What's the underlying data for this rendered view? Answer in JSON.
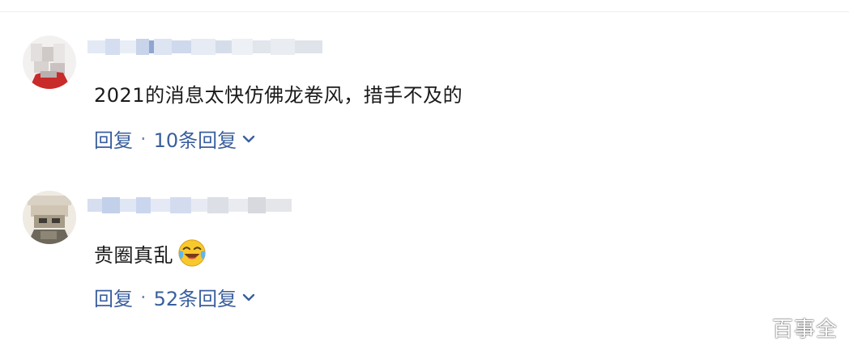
{
  "comments": [
    {
      "text": "2021的消息太快仿佛龙卷风，措手不及的",
      "reply_label": "回复",
      "separator": "·",
      "replies_label": "10条回复"
    },
    {
      "text": "贵圈真乱",
      "reply_label": "回复",
      "separator": "·",
      "replies_label": "52条回复"
    }
  ],
  "colors": {
    "link": "#3a5f9e",
    "text": "#1a1a1a"
  },
  "icons": [
    "chevron-down-icon",
    "crying-laughing-emoji-icon"
  ],
  "watermark": {
    "text": "百事全"
  }
}
